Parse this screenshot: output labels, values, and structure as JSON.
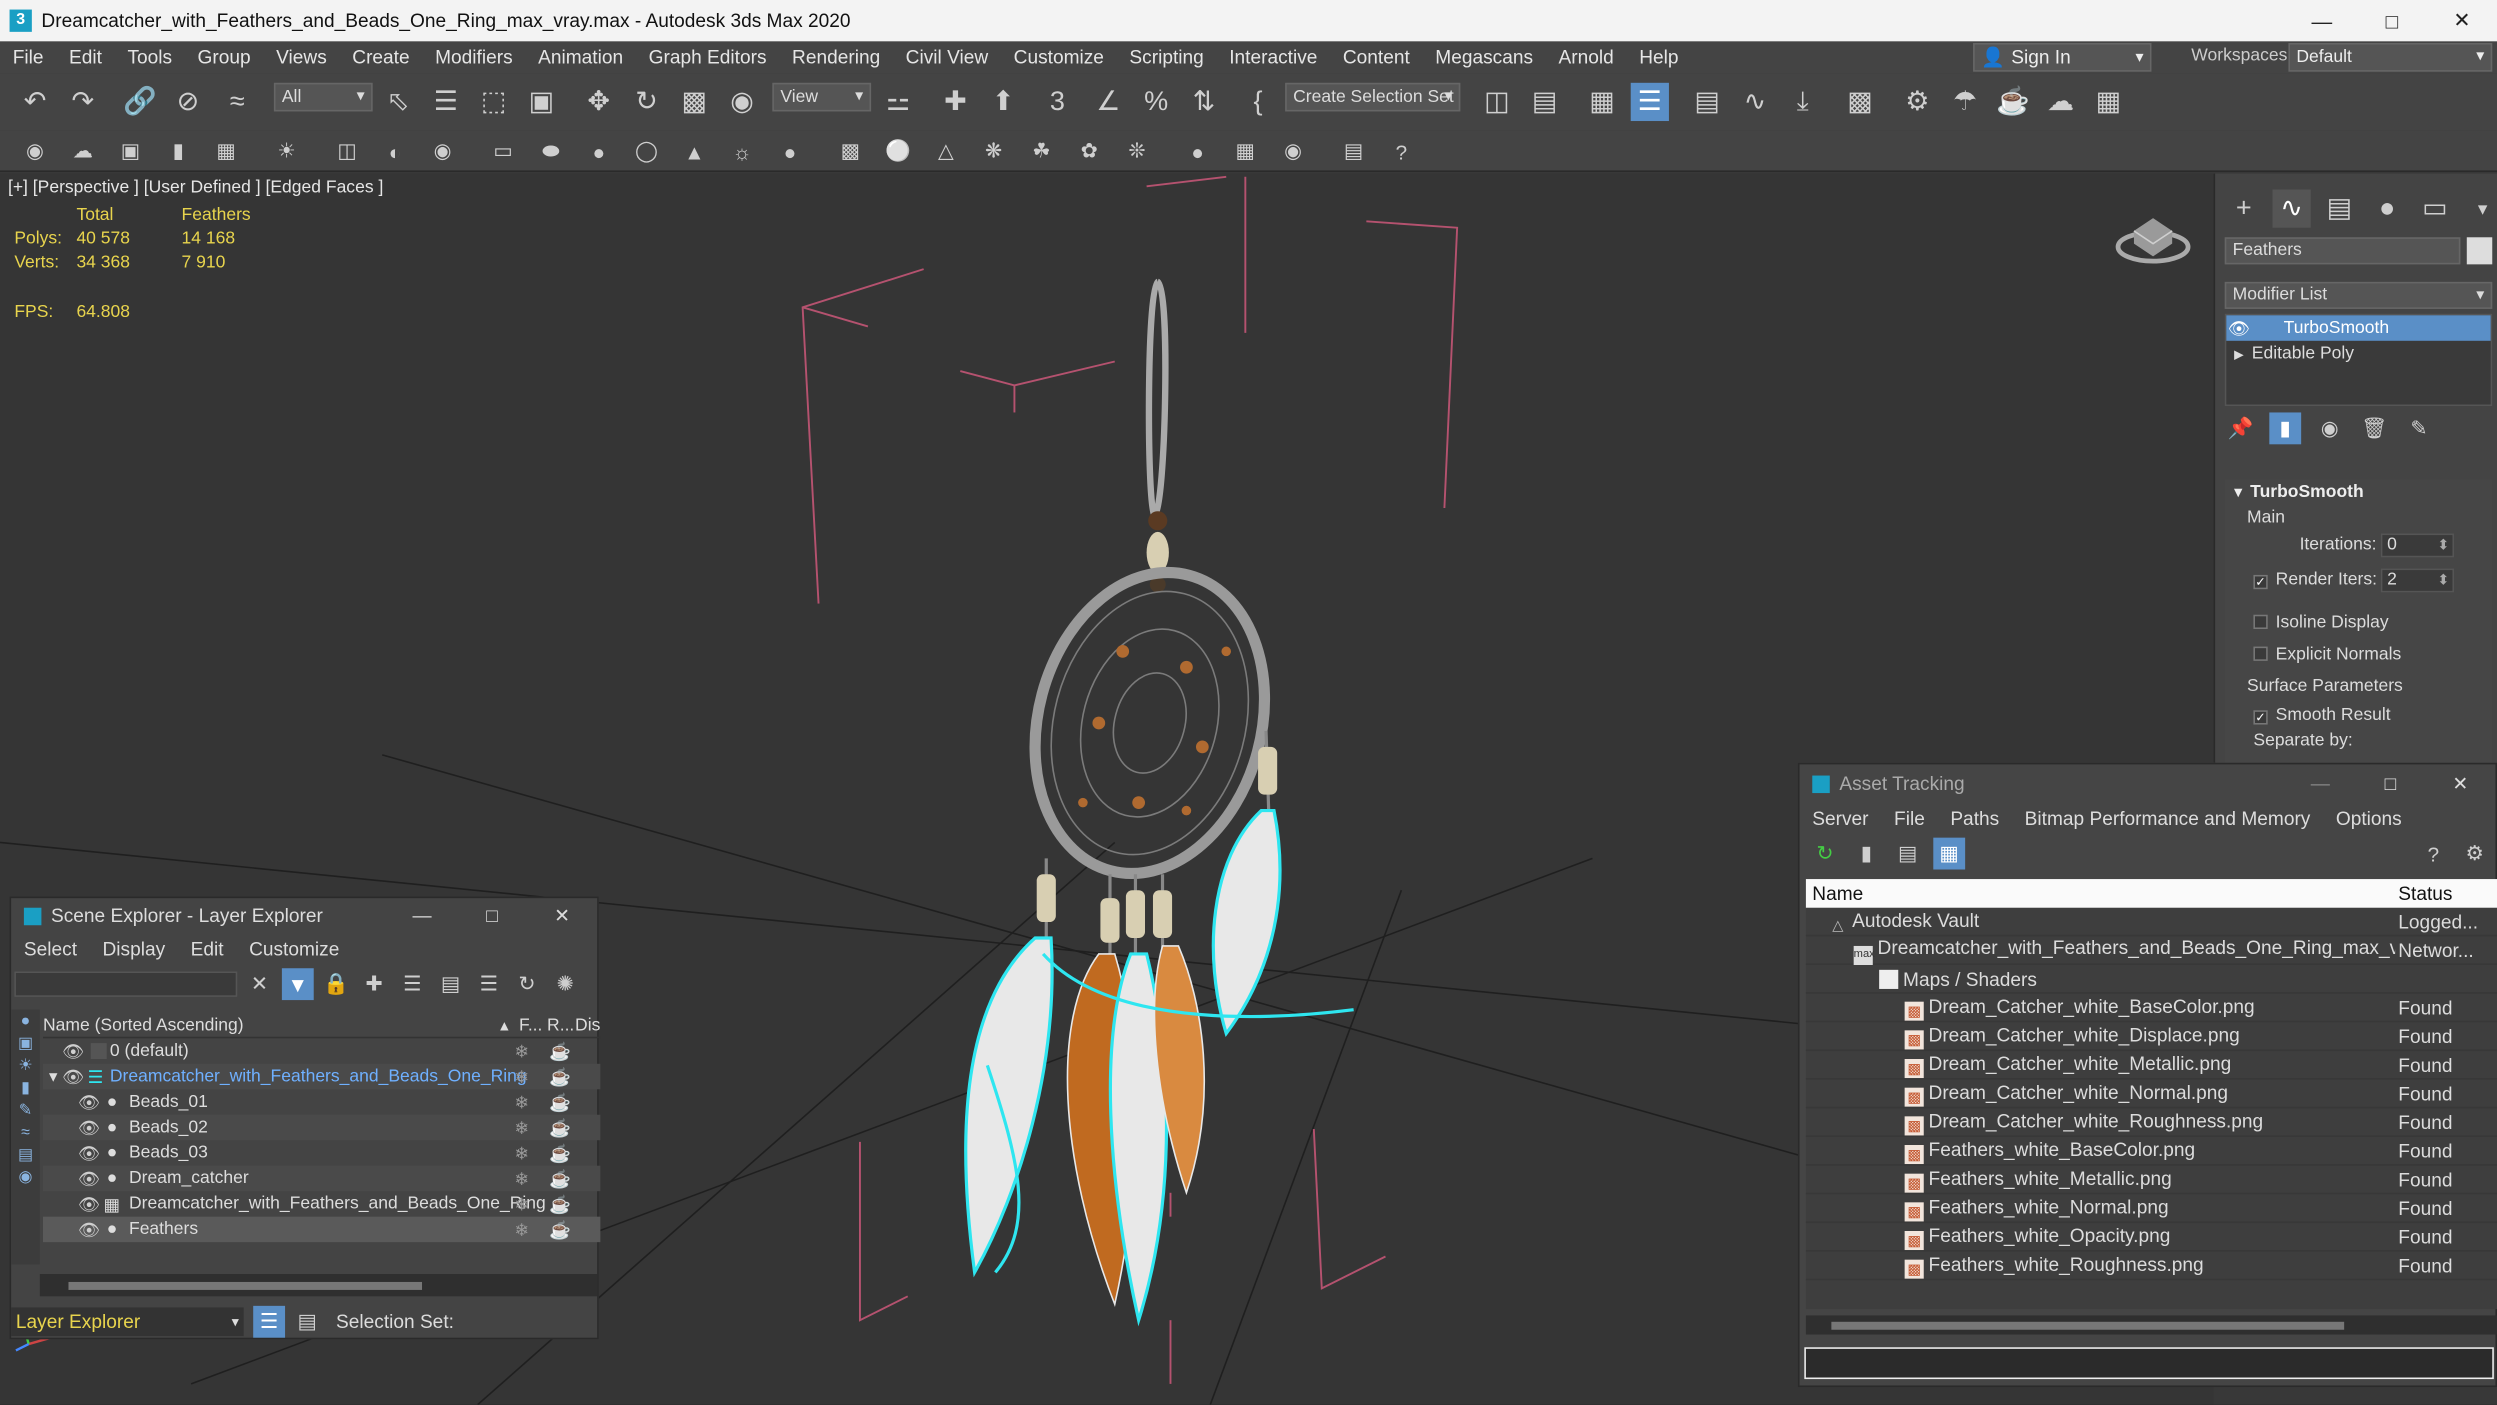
{
  "window": {
    "title": "Dreamcatcher_with_Feathers_and_Beads_One_Ring_max_vray.max - Autodesk 3ds Max 2020",
    "app_icon": "3"
  },
  "menu": [
    "File",
    "Edit",
    "Tools",
    "Group",
    "Views",
    "Create",
    "Modifiers",
    "Animation",
    "Graph Editors",
    "Rendering",
    "Civil View",
    "Customize",
    "Scripting",
    "Interactive",
    "Content",
    "Megascans",
    "Arnold",
    "Help"
  ],
  "account": {
    "sign_in": "Sign In",
    "workspaces_label": "Workspaces:",
    "workspace": "Default"
  },
  "toolbar": {
    "filter": "All",
    "ref_coord": "View",
    "selection_set": "Create Selection Set"
  },
  "viewport": {
    "label": "[+] [Perspective ] [User Defined ] [Edged Faces ]",
    "stats_headers": [
      "Total",
      "Feathers"
    ],
    "stats": [
      {
        "label": "Polys:",
        "total": "40 578",
        "sel": "14 168"
      },
      {
        "label": "Verts:",
        "total": "34 368",
        "sel": "7 910"
      }
    ],
    "fps_label": "FPS:",
    "fps_value": "64.808"
  },
  "command_panel": {
    "object_name": "Feathers",
    "modifier_list": "Modifier List",
    "stack": [
      "TurboSmooth",
      "Editable Poly"
    ],
    "rollout_title": "TurboSmooth",
    "main_label": "Main",
    "iterations_label": "Iterations:",
    "iterations_value": "0",
    "render_iters_label": "Render Iters:",
    "render_iters_value": "2",
    "isoline": "Isoline Display",
    "explicit_normals": "Explicit Normals",
    "surface_params": "Surface Parameters",
    "smooth_result": "Smooth Result",
    "separate_by": "Separate by:"
  },
  "scene_explorer": {
    "title": "Scene Explorer - Layer Explorer",
    "menu": [
      "Select",
      "Display",
      "Edit",
      "Customize"
    ],
    "columns": [
      "Name (Sorted Ascending)",
      "F...",
      "R...",
      "Dis"
    ],
    "rows": [
      {
        "name": "0 (default)",
        "level": 0
      },
      {
        "name": "Dreamcatcher_with_Feathers_and_Beads_One_Ring",
        "level": 0
      },
      {
        "name": "Beads_01",
        "level": 1
      },
      {
        "name": "Beads_02",
        "level": 1
      },
      {
        "name": "Beads_03",
        "level": 1
      },
      {
        "name": "Dream_catcher",
        "level": 1
      },
      {
        "name": "Dreamcatcher_with_Feathers_and_Beads_One_Ring",
        "level": 1
      },
      {
        "name": "Feathers",
        "level": 1
      }
    ],
    "footer_dropdown": "Layer Explorer",
    "selection_set_label": "Selection Set:"
  },
  "asset_tracking": {
    "title": "Asset Tracking",
    "menu": [
      "Server",
      "File",
      "Paths",
      "Bitmap Performance and Memory",
      "Options"
    ],
    "columns": [
      "Name",
      "Status"
    ],
    "rows": [
      {
        "name": "Autodesk Vault",
        "status": "Logged..."
      },
      {
        "name": "Dreamcatcher_with_Feathers_and_Beads_One_Ring_max_vray.max",
        "status": "Networ..."
      },
      {
        "name": "Maps / Shaders",
        "status": ""
      },
      {
        "name": "Dream_Catcher_white_BaseColor.png",
        "status": "Found"
      },
      {
        "name": "Dream_Catcher_white_Displace.png",
        "status": "Found"
      },
      {
        "name": "Dream_Catcher_white_Metallic.png",
        "status": "Found"
      },
      {
        "name": "Dream_Catcher_white_Normal.png",
        "status": "Found"
      },
      {
        "name": "Dream_Catcher_white_Roughness.png",
        "status": "Found"
      },
      {
        "name": "Feathers_white_BaseColor.png",
        "status": "Found"
      },
      {
        "name": "Feathers_white_Metallic.png",
        "status": "Found"
      },
      {
        "name": "Feathers_white_Normal.png",
        "status": "Found"
      },
      {
        "name": "Feathers_white_Opacity.png",
        "status": "Found"
      },
      {
        "name": "Feathers_white_Roughness.png",
        "status": "Found"
      }
    ]
  },
  "colors": {
    "accent": "#5a8fc7",
    "stats": "#e8d44d",
    "selection": "#2ee6f0"
  }
}
